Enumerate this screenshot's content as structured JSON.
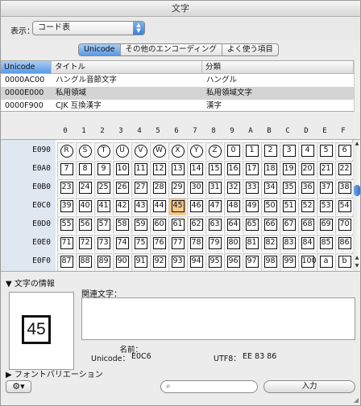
{
  "window_title": "文字",
  "toolbar": {
    "show_label": "表示：",
    "view_select": "コード表"
  },
  "tabs": [
    {
      "label": "Unicode",
      "active": true
    },
    {
      "label": "その他のエンコーディング",
      "active": false
    },
    {
      "label": "よく使う項目",
      "active": false
    }
  ],
  "encoding_table": {
    "headers": [
      "Unicode",
      "タイトル",
      "分類"
    ],
    "rows": [
      {
        "code": "0000AC00",
        "title": "ハングル音節文字",
        "category": "ハングル",
        "selected": false
      },
      {
        "code": "0000E000",
        "title": "私用領域",
        "category": "私用領域文字",
        "selected": true
      },
      {
        "code": "0000F900",
        "title": "CJK 互換漢字",
        "category": "漢字",
        "selected": false
      }
    ]
  },
  "column_headers": [
    "0",
    "1",
    "2",
    "3",
    "4",
    "5",
    "6",
    "7",
    "8",
    "9",
    "A",
    "B",
    "C",
    "D",
    "E",
    "F"
  ],
  "grid": {
    "rows": [
      {
        "label": "E090",
        "cells": [
          "R",
          "S",
          "T",
          "U",
          "V",
          "W",
          "X",
          "Y",
          "Z",
          "0",
          "1",
          "2",
          "3",
          "4",
          "5",
          "6"
        ]
      },
      {
        "label": "E0A0",
        "cells": [
          "7",
          "8",
          "9",
          "10",
          "11",
          "12",
          "13",
          "14",
          "15",
          "16",
          "17",
          "18",
          "19",
          "20",
          "21",
          "22"
        ]
      },
      {
        "label": "E0B0",
        "cells": [
          "23",
          "24",
          "25",
          "26",
          "27",
          "28",
          "29",
          "30",
          "31",
          "32",
          "33",
          "34",
          "35",
          "36",
          "37",
          "38"
        ]
      },
      {
        "label": "E0C0",
        "cells": [
          "39",
          "40",
          "41",
          "42",
          "43",
          "44",
          "45",
          "46",
          "47",
          "48",
          "49",
          "50",
          "51",
          "52",
          "53",
          "54"
        ]
      },
      {
        "label": "E0D0",
        "cells": [
          "55",
          "56",
          "57",
          "58",
          "59",
          "60",
          "61",
          "62",
          "63",
          "64",
          "65",
          "66",
          "67",
          "68",
          "69",
          "70"
        ]
      },
      {
        "label": "E0E0",
        "cells": [
          "71",
          "72",
          "73",
          "74",
          "75",
          "76",
          "77",
          "78",
          "79",
          "80",
          "81",
          "82",
          "83",
          "84",
          "85",
          "86"
        ]
      },
      {
        "label": "E0F0",
        "cells": [
          "87",
          "88",
          "89",
          "90",
          "91",
          "92",
          "93",
          "94",
          "95",
          "96",
          "97",
          "98",
          "99",
          "100",
          "a",
          "b"
        ]
      }
    ],
    "selected": {
      "row": 3,
      "col": 6
    }
  },
  "info": {
    "disclosure_label": "文字の情報",
    "preview_glyph": "45",
    "related_label": "関連文字：",
    "name_label": "名前：",
    "unicode_label": "Unicode：",
    "unicode_value": "E0C6",
    "utf8_label": "UTF8：",
    "utf8_value": "EE 83 86"
  },
  "variation_label": "フォントバリエーション",
  "bottom": {
    "gear_icon": "gear-icon",
    "search_placeholder": "",
    "insert_label": "入力"
  }
}
